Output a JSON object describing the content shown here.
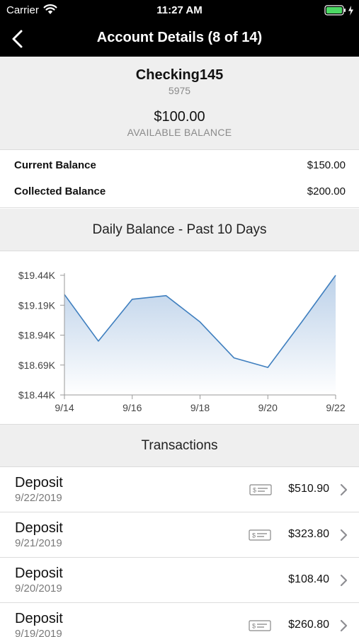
{
  "status_bar": {
    "carrier": "Carrier",
    "time": "11:27 AM"
  },
  "nav": {
    "title": "Account Details (8 of 14)"
  },
  "account": {
    "name": "Checking145",
    "number": "5975",
    "available_balance": "$100.00",
    "available_label": "AVAILABLE BALANCE"
  },
  "balances": [
    {
      "label": "Current Balance",
      "value": "$150.00"
    },
    {
      "label": "Collected Balance",
      "value": "$200.00"
    }
  ],
  "chart_section": {
    "title": "Daily Balance - Past 10 Days"
  },
  "chart_data": {
    "type": "area",
    "title": "Daily Balance - Past 10 Days",
    "x": [
      "9/14",
      "9/15",
      "9/16",
      "9/17",
      "9/18",
      "9/19",
      "9/20",
      "9/21",
      "9/22"
    ],
    "values": [
      19280,
      18890,
      19240,
      19270,
      19050,
      18750,
      18670,
      19050,
      19440
    ],
    "x_tick_labels": [
      "9/14",
      "9/16",
      "9/18",
      "9/20",
      "9/22"
    ],
    "y_tick_labels": [
      "$19.44K",
      "$19.19K",
      "$18.94K",
      "$18.69K",
      "$18.44K"
    ],
    "y_ticks": [
      19440,
      19190,
      18940,
      18690,
      18440
    ],
    "ylim": [
      18440,
      19440
    ],
    "grid": false,
    "line_color": "#3f7fbf",
    "fill_color": "#b9cfe8"
  },
  "transactions_section": {
    "title": "Transactions"
  },
  "transactions": [
    {
      "type": "Deposit",
      "date": "9/22/2019",
      "amount": "$510.90",
      "has_check": true
    },
    {
      "type": "Deposit",
      "date": "9/21/2019",
      "amount": "$323.80",
      "has_check": true
    },
    {
      "type": "Deposit",
      "date": "9/20/2019",
      "amount": "$108.40",
      "has_check": false
    },
    {
      "type": "Deposit",
      "date": "9/19/2019",
      "amount": "$260.80",
      "has_check": true
    }
  ],
  "icons": {
    "back": "chevron-left-icon",
    "row_arrow": "chevron-right-icon",
    "check": "check-image-icon",
    "wifi": "wifi-icon",
    "battery": "battery-icon"
  },
  "colors": {
    "nav_background": "#000000",
    "battery": "#4cd964",
    "section_background": "#efefef"
  }
}
